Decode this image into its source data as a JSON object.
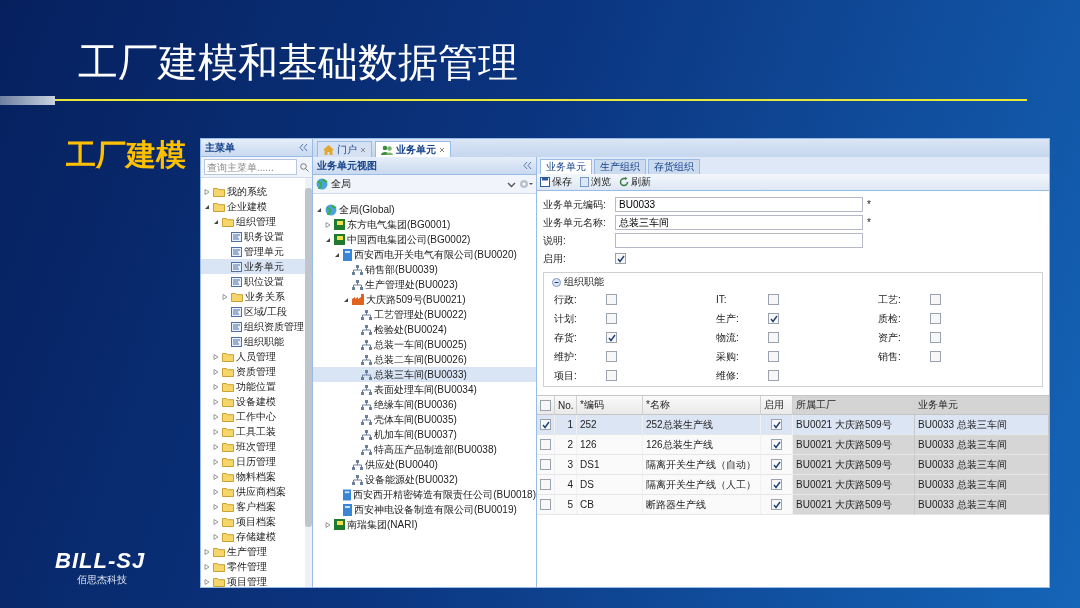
{
  "slide": {
    "title": "工厂建模和基础数据管理",
    "subtitle": "工厂建模",
    "logo": {
      "name": "BILL-SJ",
      "tagline": "佰思杰科技"
    }
  },
  "main_menu": {
    "title": "主菜单",
    "search": {
      "placeholder": "查询主菜单......"
    },
    "tree": [
      {
        "label": "我的系统",
        "kind": "folder",
        "expanded": false,
        "selected": false
      },
      {
        "label": "企业建模",
        "kind": "folder",
        "expanded": true,
        "selected": false,
        "children": [
          {
            "label": "组织管理",
            "kind": "folder",
            "expanded": true,
            "selected": false,
            "children": [
              {
                "label": "职务设置",
                "kind": "page",
                "selected": false
              },
              {
                "label": "管理单元",
                "kind": "page",
                "selected": false
              },
              {
                "label": "业务单元",
                "kind": "page",
                "selected": true
              },
              {
                "label": "职位设置",
                "kind": "page",
                "selected": false
              },
              {
                "label": "业务关系",
                "kind": "folder",
                "expanded": false,
                "selected": false
              },
              {
                "label": "区域/工段",
                "kind": "page",
                "selected": false
              },
              {
                "label": "组织资质管理",
                "kind": "page",
                "selected": false
              },
              {
                "label": "组织职能",
                "kind": "page",
                "selected": false
              }
            ]
          },
          {
            "label": "人员管理",
            "kind": "folder",
            "expanded": false,
            "selected": false
          },
          {
            "label": "资质管理",
            "kind": "folder",
            "expanded": false,
            "selected": false
          },
          {
            "label": "功能位置",
            "kind": "folder",
            "expanded": false,
            "selected": false
          },
          {
            "label": "设备建模",
            "kind": "folder",
            "expanded": false,
            "selected": false
          },
          {
            "label": "工作中心",
            "kind": "folder",
            "expanded": false,
            "selected": false
          },
          {
            "label": "工具工装",
            "kind": "folder",
            "expanded": false,
            "selected": false
          },
          {
            "label": "班次管理",
            "kind": "folder",
            "expanded": false,
            "selected": false
          },
          {
            "label": "日历管理",
            "kind": "folder",
            "expanded": false,
            "selected": false
          },
          {
            "label": "物料档案",
            "kind": "folder",
            "expanded": false,
            "selected": false
          },
          {
            "label": "供应商档案",
            "kind": "folder",
            "expanded": false,
            "selected": false
          },
          {
            "label": "客户档案",
            "kind": "folder",
            "expanded": false,
            "selected": false
          },
          {
            "label": "项目档案",
            "kind": "folder",
            "expanded": false,
            "selected": false
          },
          {
            "label": "存储建模",
            "kind": "folder",
            "expanded": false,
            "selected": false
          }
        ]
      },
      {
        "label": "生产管理",
        "kind": "folder",
        "expanded": false,
        "selected": false
      },
      {
        "label": "零件管理",
        "kind": "folder",
        "expanded": false,
        "selected": false
      },
      {
        "label": "项目管理",
        "kind": "folder",
        "expanded": false,
        "selected": false
      }
    ]
  },
  "doc_tabs": [
    {
      "label": "门户",
      "kind": "home",
      "selected": false
    },
    {
      "label": "业务单元",
      "kind": "unit",
      "selected": true
    }
  ],
  "unit_view": {
    "title": "业务单元视图",
    "scope_select": {
      "value": "全局"
    },
    "tree": [
      {
        "label": "全局(Global)",
        "kind": "global",
        "expanded": true,
        "selected": false,
        "children": [
          {
            "label": "东方电气集团(BG0001)",
            "kind": "group",
            "expanded": false,
            "selected": false
          },
          {
            "label": "中国西电集团公司(BG0002)",
            "kind": "group",
            "expanded": true,
            "selected": false,
            "children": [
              {
                "label": "西安西电开关电气有限公司(BU0020)",
                "kind": "company",
                "expanded": true,
                "selected": false,
                "children": [
                  {
                    "label": "销售部(BU0039)",
                    "kind": "unit",
                    "selected": false
                  },
                  {
                    "label": "生产管理处(BU0023)",
                    "kind": "unit",
                    "selected": false
                  },
                  {
                    "label": "大庆路509号(BU0021)",
                    "kind": "plant",
                    "expanded": true,
                    "selected": false,
                    "children": [
                      {
                        "label": "工艺管理处(BU0022)",
                        "kind": "unit",
                        "selected": false
                      },
                      {
                        "label": "检验处(BU0024)",
                        "kind": "unit",
                        "selected": false
                      },
                      {
                        "label": "总装一车间(BU0025)",
                        "kind": "unit",
                        "selected": false
                      },
                      {
                        "label": "总装二车间(BU0026)",
                        "kind": "unit",
                        "selected": false
                      },
                      {
                        "label": "总装三车间(BU0033)",
                        "kind": "unit",
                        "selected": true
                      },
                      {
                        "label": "表面处理车间(BU0034)",
                        "kind": "unit",
                        "selected": false
                      },
                      {
                        "label": "绝缘车间(BU0036)",
                        "kind": "unit",
                        "selected": false
                      },
                      {
                        "label": "壳体车间(BU0035)",
                        "kind": "unit",
                        "selected": false
                      },
                      {
                        "label": "机加车间(BU0037)",
                        "kind": "unit",
                        "selected": false
                      },
                      {
                        "label": "特高压产品制造部(BU0038)",
                        "kind": "unit",
                        "selected": false
                      }
                    ]
                  },
                  {
                    "label": "供应处(BU0040)",
                    "kind": "unit",
                    "selected": false
                  },
                  {
                    "label": "设备能源处(BU0032)",
                    "kind": "unit",
                    "selected": false
                  }
                ]
              },
              {
                "label": "西安西开精密铸造有限责任公司(BU0018)",
                "kind": "company",
                "selected": false
              },
              {
                "label": "西安神电设备制造有限公司(BU0019)",
                "kind": "company",
                "selected": false
              }
            ]
          },
          {
            "label": "南瑞集团(NARI)",
            "kind": "group",
            "expanded": false,
            "selected": false
          }
        ]
      }
    ]
  },
  "detail": {
    "tabs": [
      {
        "label": "业务单元",
        "selected": true
      },
      {
        "label": "生产组织",
        "selected": false
      },
      {
        "label": "存货组织",
        "selected": false
      }
    ],
    "toolbar": [
      {
        "label": "保存",
        "kind": "save"
      },
      {
        "label": "浏览",
        "kind": "browse"
      },
      {
        "label": "刷新",
        "kind": "refresh"
      }
    ],
    "fields": [
      {
        "label": "业务单元编码:",
        "value": "BU0033",
        "required_mark": "*"
      },
      {
        "label": "业务单元名称:",
        "value": "总装三车间",
        "required_mark": "*"
      },
      {
        "label": "说明:"
      }
    ],
    "enabled": {
      "label": "启用:",
      "checked": true
    },
    "functions": {
      "title": "组织职能",
      "expanded": true,
      "items": [
        {
          "label": "行政:",
          "checked": false
        },
        {
          "label": "IT:",
          "checked": false
        },
        {
          "label": "工艺:",
          "checked": false
        },
        {
          "label": "计划:",
          "checked": false
        },
        {
          "label": "生产:",
          "checked": true
        },
        {
          "label": "质检:",
          "checked": false
        },
        {
          "label": "存货:",
          "checked": true
        },
        {
          "label": "物流:",
          "checked": false
        },
        {
          "label": "资产:",
          "checked": false
        },
        {
          "label": "维护:",
          "checked": false
        },
        {
          "label": "采购:",
          "checked": false
        },
        {
          "label": "销售:",
          "checked": false
        },
        {
          "label": "项目:",
          "checked": false
        },
        {
          "label": "维修:",
          "checked": false
        }
      ]
    },
    "table": {
      "all_checked": false,
      "columns": [
        "No.",
        "*编码",
        "*名称",
        "启用",
        "所属工厂",
        "业务单元"
      ],
      "rows": [
        {
          "selected": true,
          "no": "1",
          "code": "252",
          "name": "252总装生产线",
          "enabled": true,
          "plant": "BU0021 大庆路509号",
          "unit": "BU0033 总装三车间"
        },
        {
          "selected": false,
          "no": "2",
          "code": "126",
          "name": "126总装生产线",
          "enabled": true,
          "plant": "BU0021 大庆路509号",
          "unit": "BU0033 总装三车间"
        },
        {
          "selected": false,
          "no": "3",
          "code": "DS1",
          "name": "隔离开关生产线（自动）",
          "enabled": true,
          "plant": "BU0021 大庆路509号",
          "unit": "BU0033 总装三车间"
        },
        {
          "selected": false,
          "no": "4",
          "code": "DS",
          "name": "隔离开关生产线（人工）",
          "enabled": true,
          "plant": "BU0021 大庆路509号",
          "unit": "BU0033 总装三车间"
        },
        {
          "selected": false,
          "no": "5",
          "code": "CB",
          "name": "断路器生产线",
          "enabled": true,
          "plant": "BU0021 大庆路509号",
          "unit": "BU0033 总装三车间"
        }
      ]
    }
  }
}
